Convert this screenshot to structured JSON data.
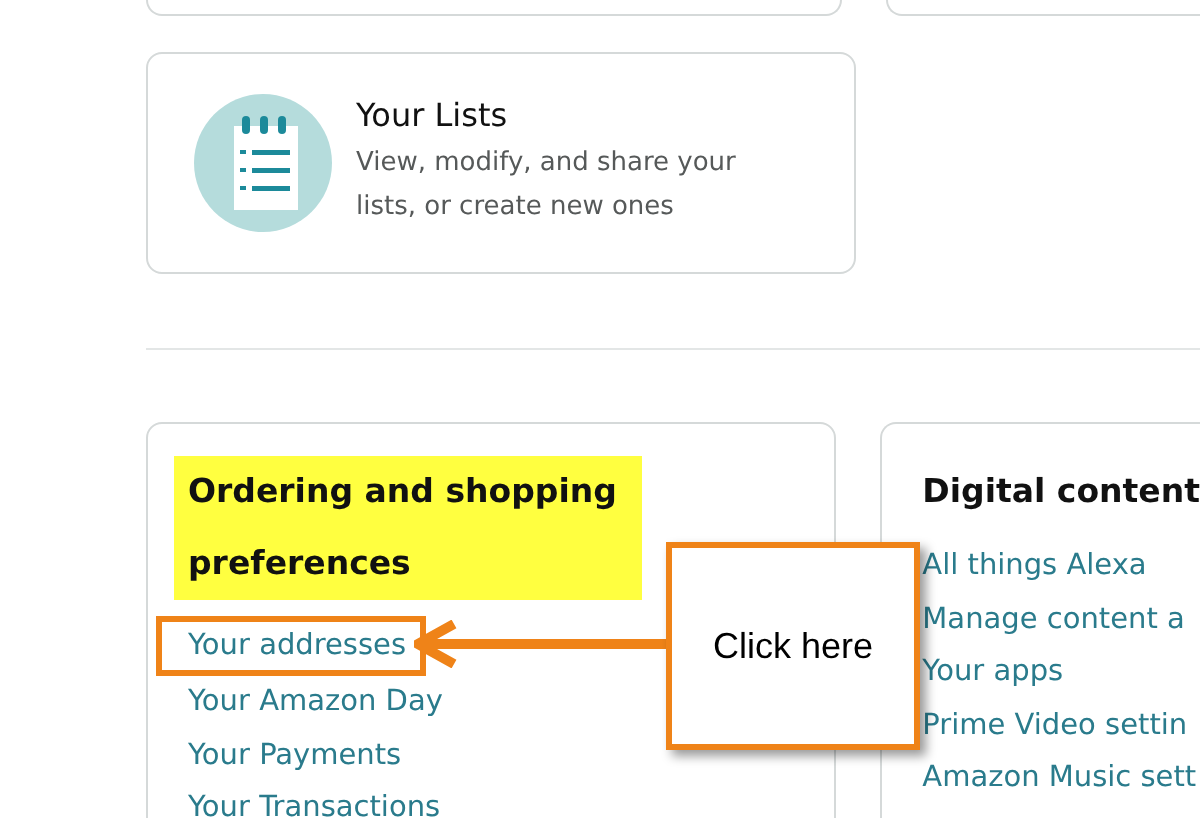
{
  "lists_card": {
    "title": "Your Lists",
    "description": "View, modify, and share your lists, or create new ones"
  },
  "sections": [
    {
      "heading": "Ordering and shopping preferences",
      "highlighted": true,
      "links": [
        {
          "label": "Your addresses",
          "outlined": true
        },
        {
          "label": "Your Amazon Day",
          "outlined": false
        },
        {
          "label": "Your Payments",
          "outlined": false
        },
        {
          "label": "Your Transactions",
          "outlined": false
        }
      ]
    },
    {
      "heading": "Digital content",
      "highlighted": false,
      "links": [
        {
          "label": "All things Alexa",
          "outlined": false
        },
        {
          "label": "Manage content a",
          "outlined": false
        },
        {
          "label": "Your apps",
          "outlined": false
        },
        {
          "label": "Prime Video settin",
          "outlined": false
        },
        {
          "label": "Amazon Music sett",
          "outlined": false
        }
      ]
    }
  ],
  "callout": {
    "text": "Click here"
  }
}
